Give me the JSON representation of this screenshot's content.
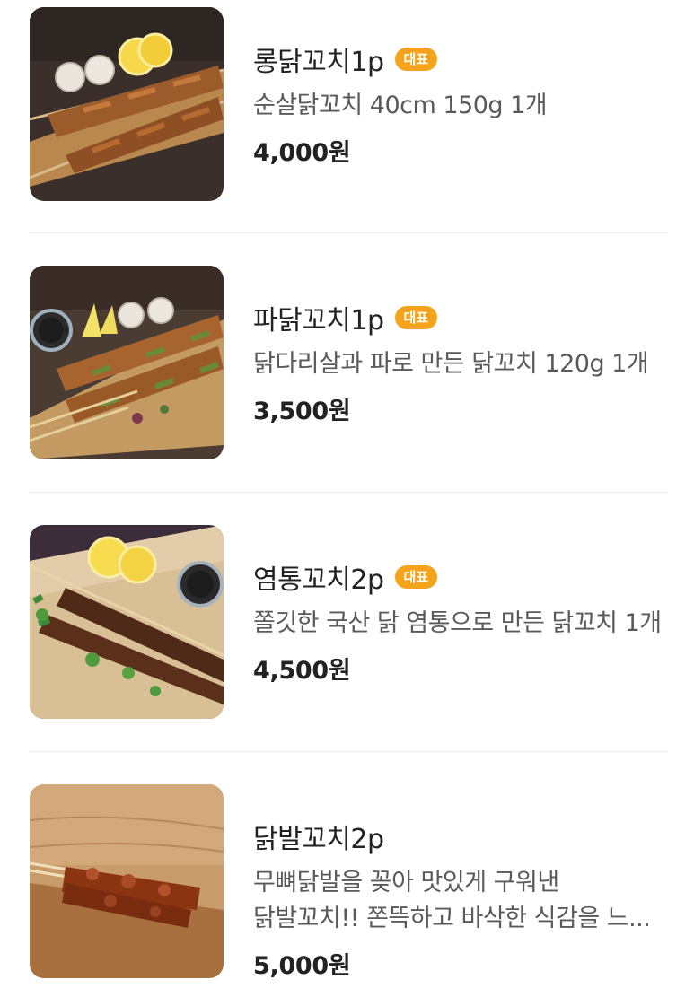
{
  "menu_items": [
    {
      "name": "롱닭꼬치1p",
      "badge": "대표",
      "description": "순살닭꼬치 40cm 150g 1개",
      "price": "4,000원",
      "image_icon": "chicken-skewer-long-image"
    },
    {
      "name": "파닭꼬치1p",
      "badge": "대표",
      "description": "닭다리살과 파로 만든 닭꼬치 120g 1개",
      "price": "3,500원",
      "image_icon": "green-onion-chicken-skewer-image"
    },
    {
      "name": "염통꼬치2p",
      "badge": "대표",
      "description": "쫄깃한 국산 닭 염통으로 만든 닭꼬치 1개",
      "price": "4,500원",
      "image_icon": "chicken-heart-skewer-image"
    },
    {
      "name": "닭발꼬치2p",
      "badge": "",
      "description": "무뼈닭발을 꽂아 맛있게 구워낸 닭발꼬치!! 쫀뜩하고 바삭한 식감을 느...",
      "price": "5,000원",
      "image_icon": "chicken-feet-skewer-image"
    }
  ],
  "colors": {
    "badge": "#f5a31a",
    "divider": "#ececec",
    "description": "#5a5a5a"
  }
}
